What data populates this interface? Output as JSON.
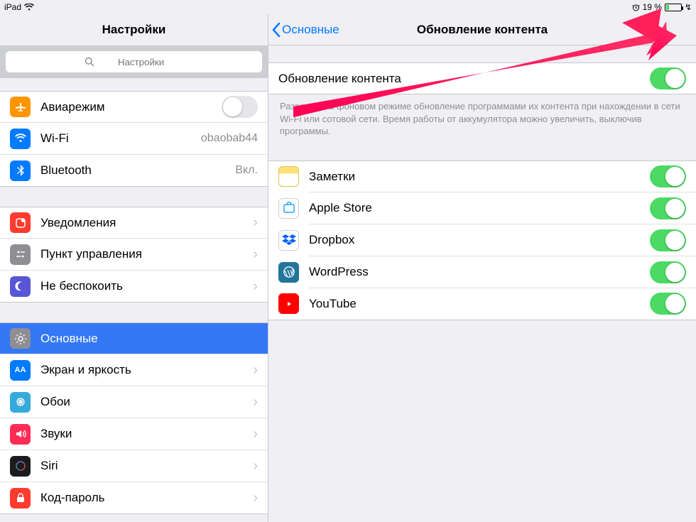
{
  "statusbar": {
    "device": "iPad",
    "battery_pct": "19 %",
    "charging_glyph": "↯"
  },
  "sidebar": {
    "title": "Настройки",
    "search_placeholder": "Настройки",
    "groups": [
      {
        "items": [
          {
            "icon": "airplane-icon",
            "label": "Авиарежим",
            "toggle": false
          },
          {
            "icon": "wifi-icon",
            "label": "Wi-Fi",
            "value": "obaobab44"
          },
          {
            "icon": "bluetooth-icon",
            "label": "Bluetooth",
            "value": "Вкл."
          }
        ]
      },
      {
        "items": [
          {
            "icon": "notifications-icon",
            "label": "Уведомления"
          },
          {
            "icon": "control-center-icon",
            "label": "Пункт управления"
          },
          {
            "icon": "dnd-icon",
            "label": "Не беспокоить"
          }
        ]
      },
      {
        "items": [
          {
            "icon": "general-icon",
            "label": "Основные",
            "selected": true
          },
          {
            "icon": "display-icon",
            "label": "Экран и яркость"
          },
          {
            "icon": "wallpaper-icon",
            "label": "Обои"
          },
          {
            "icon": "sounds-icon",
            "label": "Звуки"
          },
          {
            "icon": "siri-icon",
            "label": "Siri"
          },
          {
            "icon": "passcode-icon",
            "label": "Код-пароль"
          }
        ]
      }
    ]
  },
  "detail": {
    "back_label": "Основные",
    "title": "Обновление контента",
    "master": {
      "label": "Обновление контента",
      "toggle": true
    },
    "note": "Разрешать в фоновом режиме обновление программами их контента при нахождении в сети Wi-Fi или сотовой сети. Время работы от аккумулятора можно увеличить, выключив программы.",
    "apps": [
      {
        "icon": "notes-app-icon",
        "label": "Заметки",
        "toggle": true
      },
      {
        "icon": "appstore-app-icon",
        "label": "Apple Store",
        "toggle": true
      },
      {
        "icon": "dropbox-app-icon",
        "label": "Dropbox",
        "toggle": true
      },
      {
        "icon": "wordpress-app-icon",
        "label": "WordPress",
        "toggle": true
      },
      {
        "icon": "youtube-app-icon",
        "label": "YouTube",
        "toggle": true
      }
    ]
  }
}
